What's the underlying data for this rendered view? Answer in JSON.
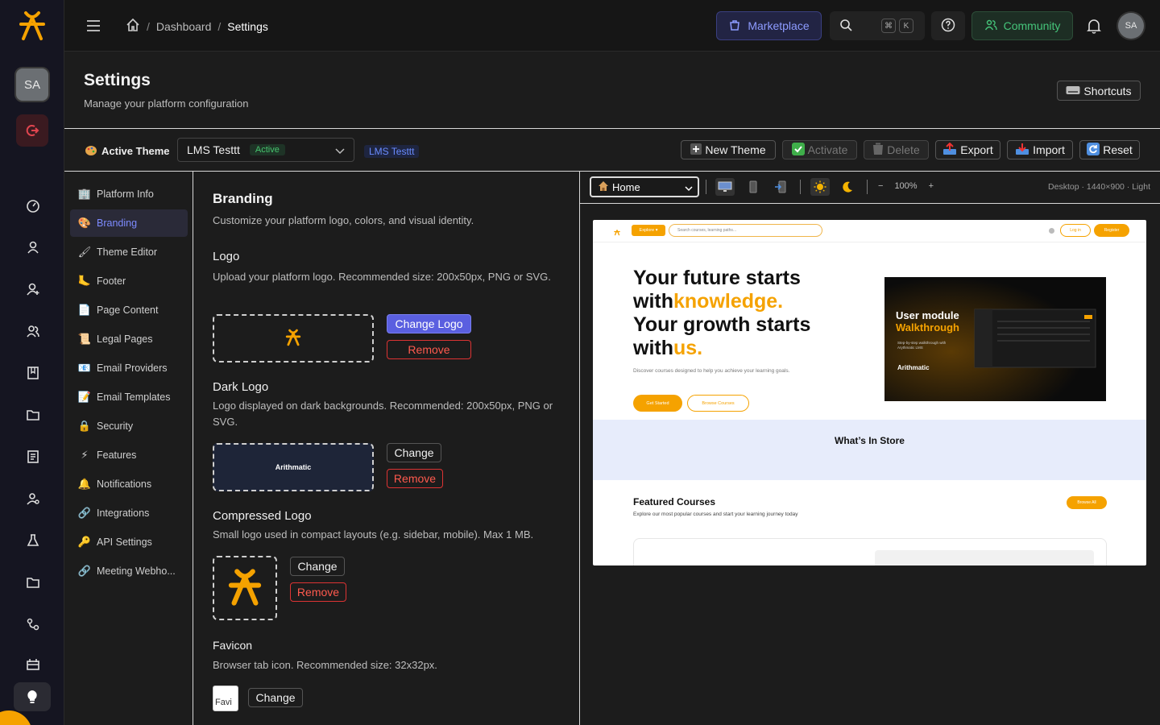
{
  "topbar": {
    "breadcrumb": [
      "Dashboard",
      "Settings"
    ],
    "marketplace": "Marketplace",
    "kbd_cmd": "⌘",
    "kbd_k": "K",
    "community": "Community",
    "avatar": "SA"
  },
  "rail": {
    "avatar": "SA"
  },
  "header": {
    "title": "Settings",
    "subtitle": "Manage your platform configuration",
    "shortcuts": "Shortcuts"
  },
  "theme": {
    "label": "Active Theme",
    "selected": "LMS Testtt",
    "badge": "Active",
    "tag": "LMS Testtt",
    "new_theme": "New Theme",
    "activate": "Activate",
    "delete": "Delete",
    "export": "Export",
    "import": "Import",
    "reset": "Reset"
  },
  "nav": [
    {
      "label": "Platform Info",
      "icon": "🏢"
    },
    {
      "label": "Branding",
      "icon": "🎨"
    },
    {
      "label": "Theme Editor",
      "icon": "🖌"
    },
    {
      "label": "Footer",
      "icon": "🦶"
    },
    {
      "label": "Page Content",
      "icon": "📄"
    },
    {
      "label": "Legal Pages",
      "icon": "📜"
    },
    {
      "label": "Email Providers",
      "icon": "📧"
    },
    {
      "label": "Email Templates",
      "icon": "📝"
    },
    {
      "label": "Security",
      "icon": "🔒"
    },
    {
      "label": "Features",
      "icon": "⚡"
    },
    {
      "label": "Notifications",
      "icon": "🔔"
    },
    {
      "label": "Integrations",
      "icon": "🔗"
    },
    {
      "label": "API Settings",
      "icon": "🔑"
    },
    {
      "label": "Meeting Webho...",
      "icon": "🔗"
    }
  ],
  "branding": {
    "title": "Branding",
    "subtitle": "Customize your platform logo, colors, and visual identity.",
    "logo": {
      "title": "Logo",
      "desc": "Upload your platform logo. Recommended size: 200x50px, PNG or SVG.",
      "change": "Change Logo",
      "remove": "Remove"
    },
    "dark_logo": {
      "title": "Dark Logo",
      "desc": "Logo displayed on dark backgrounds. Recommended: 200x50px, PNG or SVG.",
      "preview_text": "Arithmatic",
      "change": "Change",
      "remove": "Remove"
    },
    "compressed": {
      "title": "Compressed Logo",
      "desc": "Small logo used in compact layouts (e.g. sidebar, mobile). Max 1 MB.",
      "change": "Change",
      "remove": "Remove"
    },
    "favicon": {
      "title": "Favicon",
      "desc": "Browser tab icon. Recommended size: 32x32px.",
      "alt": "Favi",
      "change": "Change"
    }
  },
  "preview": {
    "page_select": "Home",
    "zoom": "100%",
    "zoom_minus": "−",
    "zoom_plus": "+",
    "info": "Desktop · 1440×900 · Light",
    "site": {
      "explore": "Explore ▾",
      "search": "Search courses, learning paths...",
      "login": "Log in",
      "register": "Register",
      "hero": [
        "Your future starts",
        "with",
        "knowledge.",
        "Your growth starts",
        "with",
        "us."
      ],
      "hero_sub": "Discover courses designed to help you achieve your learning goals.",
      "get_started": "Get Started",
      "browse_courses": "Browse Courses",
      "video_title1": "User module",
      "video_title2": "Walkthrough",
      "video_sub": "Step-by-step walkthrough with Arythmatic LMS",
      "video_brand": "Arithmatic",
      "store": "What’s In Store",
      "featured": "Featured Courses",
      "featured_sub": "Explore our most popular courses and start your learning journey today",
      "browse_all": "Browse All"
    }
  },
  "colors": {
    "accent": "#f5a200",
    "primary": "#5a5fe0",
    "danger": "#ff5a4e",
    "success": "#45c47a"
  }
}
